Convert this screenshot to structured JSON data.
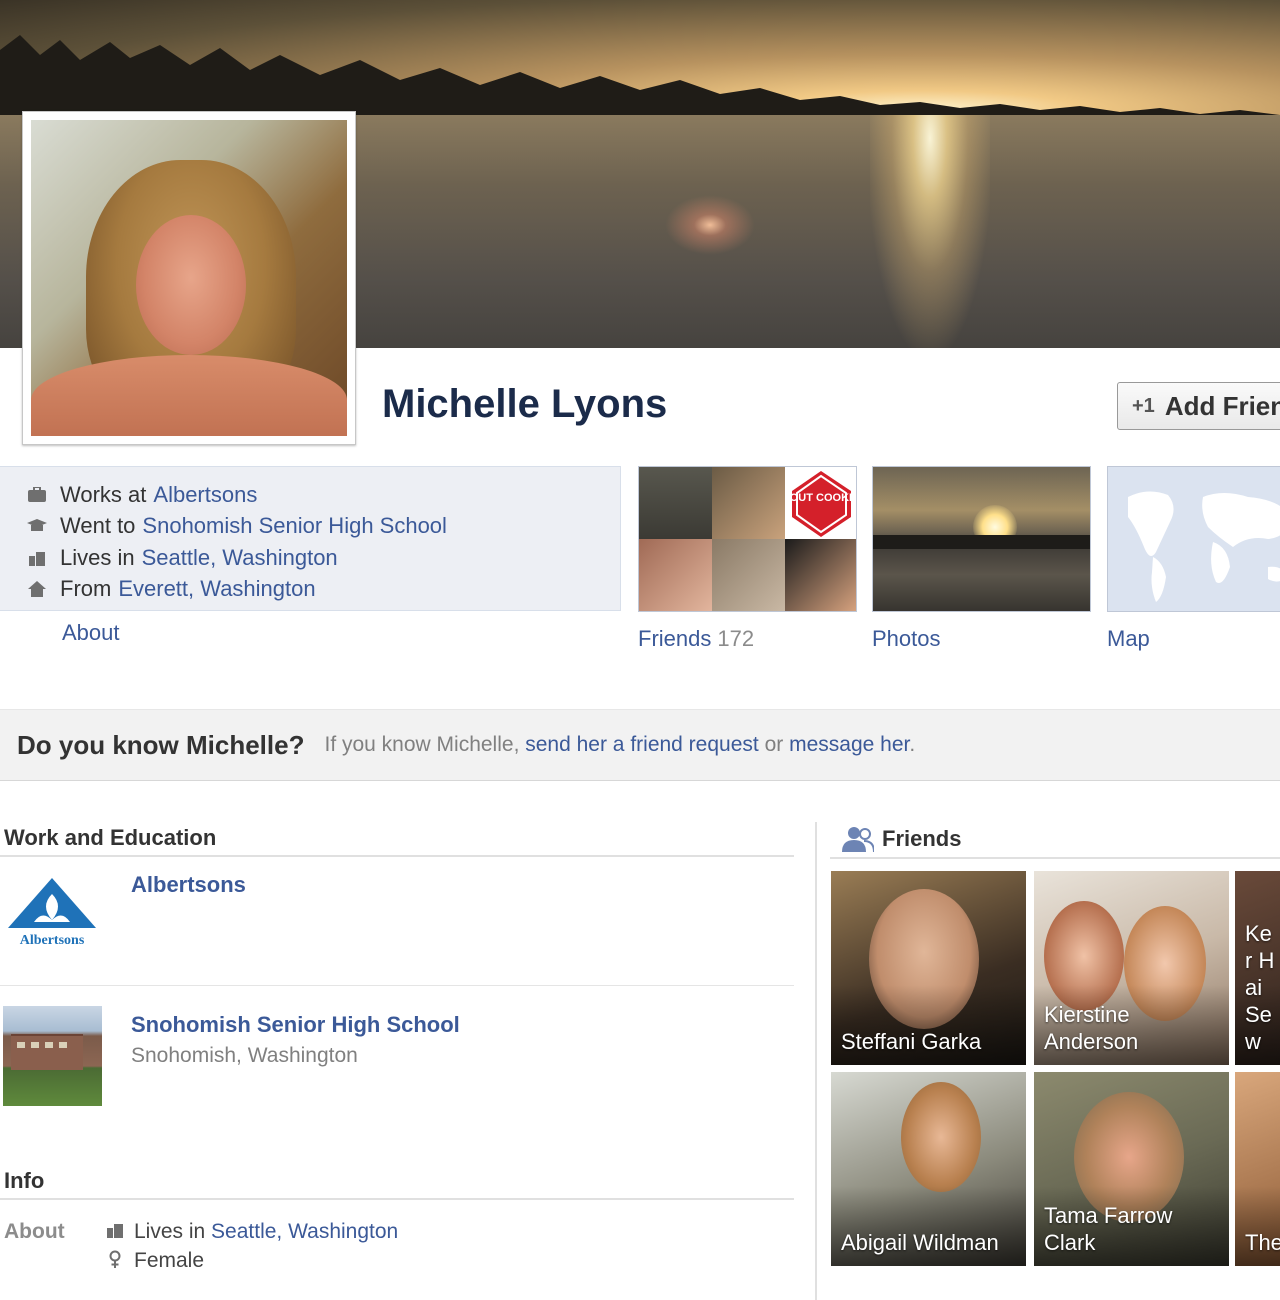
{
  "profile": {
    "name": "Michelle Lyons",
    "add_friend_label": "Add Friend"
  },
  "intro": {
    "lines": [
      {
        "icon": "briefcase-icon",
        "prefix": "Works at",
        "link": "Albertsons"
      },
      {
        "icon": "graduation-cap-icon",
        "prefix": "Went to",
        "link": "Snohomish Senior High School"
      },
      {
        "icon": "city-icon",
        "prefix": "Lives in",
        "link": "Seattle, Washington"
      },
      {
        "icon": "home-icon",
        "prefix": "From",
        "link": "Everett, Washington"
      }
    ],
    "about_link": "About"
  },
  "tiles": {
    "friends_label": "Friends",
    "friends_count": "172",
    "photos_label": "Photos",
    "map_label": "Map",
    "cookie_badge": "GIRL SCOUT COOKIE ZONE!"
  },
  "know_bar": {
    "question": "Do you know Michelle?",
    "text_before": "If you know Michelle,",
    "link_request": "send her a friend request",
    "text_or": "or",
    "link_message": "message her",
    "text_end": "."
  },
  "work_education": {
    "title": "Work and Education",
    "entries": [
      {
        "name": "Albertsons",
        "sub": "",
        "logo_text": "Albertsons"
      },
      {
        "name": "Snohomish Senior High School",
        "sub": "Snohomish, Washington"
      }
    ]
  },
  "info": {
    "title": "Info",
    "about_label": "About",
    "rows": [
      {
        "icon": "city-icon",
        "prefix": "Lives in",
        "link": "Seattle, Washington"
      },
      {
        "icon": "female-icon",
        "prefix": "Female",
        "link": ""
      }
    ]
  },
  "friends_panel": {
    "title": "Friends",
    "cards": [
      {
        "name": "Steffani Garka"
      },
      {
        "name": "Kierstine Anderson"
      },
      {
        "name": "Ker Hai Sew"
      },
      {
        "name": "Abigail Wildman"
      },
      {
        "name": "Tama Farrow Clark"
      },
      {
        "name": "The"
      }
    ]
  },
  "colors": {
    "link": "#3b5998",
    "name": "#1b2b4a",
    "infobox_bg": "#edeff4"
  }
}
